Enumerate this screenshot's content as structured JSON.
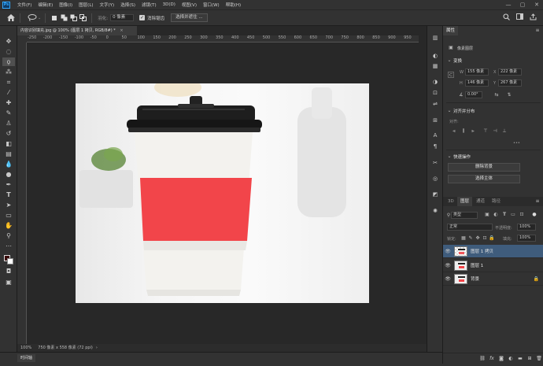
{
  "menubar": {
    "logo": "Ps",
    "items": [
      "文件(F)",
      "编辑(E)",
      "图像(I)",
      "图层(L)",
      "文字(Y)",
      "选择(S)",
      "滤镜(T)",
      "3D(D)",
      "视图(V)",
      "窗口(W)",
      "帮助(H)"
    ],
    "minimize": "—",
    "maximize": "▢",
    "close": "✕"
  },
  "options": {
    "feather_label": "羽化:",
    "feather_value": "0 像素",
    "antialias_check": "✓",
    "antialias_label": "消除锯齿",
    "select_subject": "选择并遮住 ..."
  },
  "document": {
    "tab_title": "内容识别填充.jpg @ 100% (图层 1 拷贝, RGB/8#) *",
    "tab_close": "×",
    "zoom": "100%",
    "doc_info": "750 像素 x 558 像素 (72 ppi)",
    "ruler_labels": [
      "-250",
      "-200",
      "-150",
      "-100",
      "-50",
      "0",
      "50",
      "100",
      "150",
      "200",
      "250",
      "300",
      "350",
      "400",
      "450",
      "500",
      "550",
      "600",
      "650",
      "700",
      "750",
      "800",
      "850",
      "900",
      "950"
    ]
  },
  "timeline": {
    "tab": "时间轴"
  },
  "properties": {
    "tab": "属性",
    "kind_label": "像素图层",
    "transform_title": "变换",
    "w_label": "W",
    "w_value": "155 像素",
    "x_label": "X",
    "x_value": "222 像素",
    "h_label": "H",
    "h_value": "146 像素",
    "y_label": "Y",
    "y_value": "267 像素",
    "angle_value": "0.00°",
    "align_title": "对齐并分布",
    "align_label": "对齐:",
    "more": "•••",
    "quick_title": "快速操作",
    "btn_remove_bg": "删除背景",
    "btn_select_subject": "选择主体"
  },
  "layers_panel": {
    "tabs": [
      "3D",
      "图层",
      "通道",
      "路径"
    ],
    "filter_kind": "类型",
    "blend_mode": "正常",
    "opacity_label": "不透明度:",
    "opacity_value": "100%",
    "lock_label": "锁定:",
    "fill_label": "填充:",
    "fill_value": "100%",
    "layers": [
      {
        "name": "图层 1 拷贝",
        "selected": true
      },
      {
        "name": "图层 1",
        "selected": false
      },
      {
        "name": "背景",
        "selected": false
      }
    ],
    "bottom_icons": [
      "link-icon",
      "fx-icon",
      "mask-icon",
      "adjustment-icon",
      "group-icon",
      "new-layer-icon",
      "trash-icon"
    ]
  },
  "colors": {
    "cup_red": "#f2454a",
    "lid": "#1e1e1e",
    "selection": "#3f5c7c"
  }
}
